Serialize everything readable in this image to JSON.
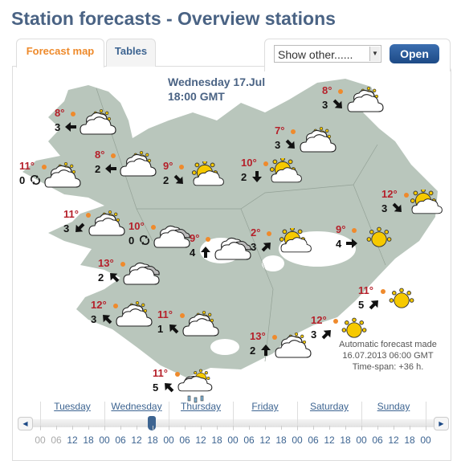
{
  "page": {
    "title": "Station forecasts - Overview stations"
  },
  "tabs": [
    {
      "label": "Forecast map",
      "active": true
    },
    {
      "label": "Tables",
      "active": false
    }
  ],
  "controls": {
    "select_value": "Show other......",
    "open_label": "Open"
  },
  "map": {
    "date": "Wednesday 17.Jul",
    "time": "18:00 GMT",
    "land_color": "#b9c6bc",
    "glacier_color": "#ffffff"
  },
  "stations": [
    {
      "temp": "8°",
      "wind": "3",
      "arrow": "left",
      "icon": "partly-cloudy"
    },
    {
      "temp": "8°",
      "wind": "2",
      "arrow": "left",
      "icon": "partly-cloudy"
    },
    {
      "temp": "11°",
      "wind": "0",
      "arrow": "variable",
      "icon": "partly-cloudy"
    },
    {
      "temp": "9°",
      "wind": "2",
      "arrow": "down-right",
      "icon": "sun-cloud"
    },
    {
      "temp": "11°",
      "wind": "3",
      "arrow": "down-left",
      "icon": "partly-cloudy"
    },
    {
      "temp": "10°",
      "wind": "0",
      "arrow": "variable",
      "icon": "cloudy"
    },
    {
      "temp": "9°",
      "wind": "4",
      "arrow": "up",
      "icon": "cloudy"
    },
    {
      "temp": "13°",
      "wind": "2",
      "arrow": "up-left",
      "icon": "cloudy"
    },
    {
      "temp": "12°",
      "wind": "3",
      "arrow": "up-left",
      "icon": "partly-cloudy"
    },
    {
      "temp": "11°",
      "wind": "1",
      "arrow": "up-left",
      "icon": "partly-cloudy"
    },
    {
      "temp": "11°",
      "wind": "5",
      "arrow": "up-left",
      "icon": "rain-partly"
    },
    {
      "temp": "13°",
      "wind": "2",
      "arrow": "up",
      "icon": "partly-cloudy"
    },
    {
      "temp": "12°",
      "wind": "3",
      "arrow": "up-right",
      "icon": "sun"
    },
    {
      "temp": "11°",
      "wind": "5",
      "arrow": "up-right",
      "icon": "sun"
    },
    {
      "temp": "9°",
      "wind": "4",
      "arrow": "right",
      "icon": "sun"
    },
    {
      "temp": "2°",
      "wind": "3",
      "arrow": "up-right",
      "icon": "sun-cloud"
    },
    {
      "temp": "10°",
      "wind": "2",
      "arrow": "down",
      "icon": "sun-cloud"
    },
    {
      "temp": "7°",
      "wind": "3",
      "arrow": "down-right",
      "icon": "partly-cloudy"
    },
    {
      "temp": "8°",
      "wind": "3",
      "arrow": "down-right",
      "icon": "partly-cloudy"
    },
    {
      "temp": "12°",
      "wind": "3",
      "arrow": "down-right",
      "icon": "sun-cloud"
    }
  ],
  "note": {
    "line1": "Automatic forecast made",
    "line2": "16.07.2013 06:00 GMT",
    "line3": "Time-span: +36 h."
  },
  "timeline": {
    "days": [
      "Tuesday",
      "Wednesday",
      "Thursday",
      "Friday",
      "Saturday",
      "Sunday"
    ],
    "hours": [
      "00",
      "06",
      "12",
      "18",
      "00",
      "06",
      "12",
      "18",
      "00",
      "06",
      "12",
      "18",
      "00",
      "06",
      "12",
      "18",
      "00",
      "06",
      "12",
      "18",
      "00",
      "06",
      "12",
      "18",
      "00"
    ],
    "unavailable_hours": 2,
    "selected": "Wednesday 18",
    "accent": "#3d6491"
  }
}
